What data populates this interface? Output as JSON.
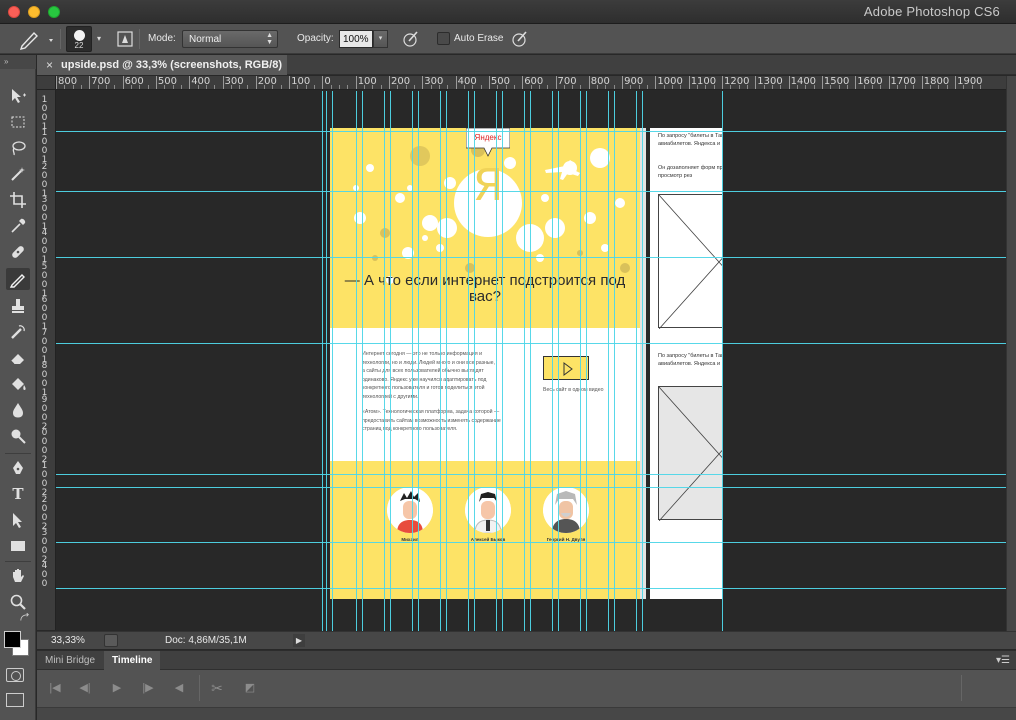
{
  "window": {
    "app_title": "Adobe Photoshop CS6"
  },
  "options_bar": {
    "brush_size": "22",
    "mode_label": "Mode:",
    "mode_value": "Normal",
    "opacity_label": "Opacity:",
    "opacity_value": "100%",
    "auto_erase_label": "Auto Erase"
  },
  "document": {
    "tab_title": "upside.psd @ 33,3% (screenshots, RGB/8)",
    "close_glyph": "×"
  },
  "rulers": {
    "top_labels": [
      "800",
      "700",
      "600",
      "500",
      "400",
      "300",
      "200",
      "100",
      "0",
      "100",
      "200",
      "300",
      "400",
      "500",
      "600",
      "700",
      "800",
      "900",
      "1000",
      "1100",
      "1200",
      "1300",
      "1400",
      "1500",
      "1600",
      "1700",
      "1800",
      "1900"
    ],
    "left_labels": [
      "1",
      "0",
      "0",
      "1",
      "1",
      "0",
      "0",
      "1",
      "2",
      "0",
      "0",
      "1",
      "3",
      "0",
      "0",
      "1",
      "4",
      "0",
      "0",
      "1",
      "5",
      "0",
      "0",
      "1",
      "6",
      "0",
      "0",
      "1",
      "7",
      "0",
      "0",
      "1",
      "8",
      "0",
      "0",
      "1",
      "9",
      "0",
      "0",
      "2",
      "0",
      "0",
      "0",
      "2",
      "1",
      "0",
      "0",
      "2",
      "2",
      "0",
      "0",
      "2",
      "3",
      "0",
      "0",
      "2",
      "4",
      "0",
      "0"
    ]
  },
  "artboard": {
    "logo_text": "Яндекс",
    "big_letter": "Я",
    "headline": "— А что если интернет подстроится под вас?",
    "body_p1": "Интернет сегодня — это не только информация и технологии, но и люди. Людей много и они все разные, а сайты для всех пользователей обычно выглядят одинаково. Яндекс уже научился адаптировать под конкретного пользователя и готов поделиться этой технологией с другими.",
    "body_p2": "«Атом». Технологическая платформа, задача которой — предоставить сайтам возможность изменять содержание страниц под конкретного пользователя.",
    "video_caption": "Весь сайт в одном видео",
    "avatars": [
      {
        "name": "Михаил"
      },
      {
        "name": "Алексей Быков"
      },
      {
        "name": "Георгий Н. Двуля"
      }
    ],
    "side_p1": "По запросу \"билеты в Таиланд\" агрегатора авиабилетов. Яндекса и на сайте оразу",
    "side_p2": "Он дозаполняет форм пр подсадит в просмотр рез",
    "side_p3": "По запросу \"билеты в Таиланд\" агрегатора авиабилетов. Яндекса и на сайте оразу"
  },
  "status": {
    "zoom": "33,33%",
    "doc_info": "Doc: 4,86M/35,1M"
  },
  "bottom_panel": {
    "tabs": [
      {
        "label": "Mini Bridge"
      },
      {
        "label": "Timeline"
      }
    ]
  },
  "colors": {
    "guide": "#4fd6e8",
    "artboard_yellow": "#fde366",
    "ui_gray": "#535353",
    "canvas_bg": "#282828"
  }
}
